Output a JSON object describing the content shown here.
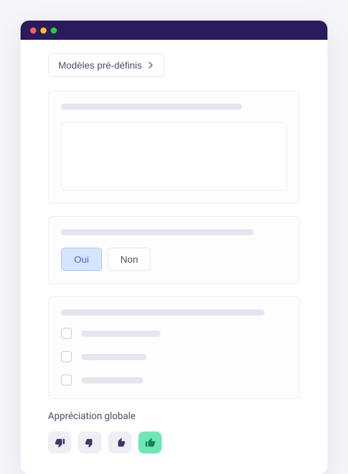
{
  "header": {
    "dropdown_label": "Modèles pré-définis"
  },
  "yesno": {
    "yes_label": "Oui",
    "no_label": "Non",
    "selected": "yes"
  },
  "rating": {
    "title": "Appréciation globale",
    "selected_index": 3,
    "options": [
      {
        "name": "thumbs-down-strong"
      },
      {
        "name": "thumbs-down"
      },
      {
        "name": "thumbs-up"
      },
      {
        "name": "thumbs-up-strong"
      }
    ]
  },
  "colors": {
    "accent_title_bar": "#2a1b5c",
    "selected_blue_bg": "#d6e4ff",
    "selected_blue_border": "#a8c5ff",
    "rating_active": "#6de8b5"
  }
}
